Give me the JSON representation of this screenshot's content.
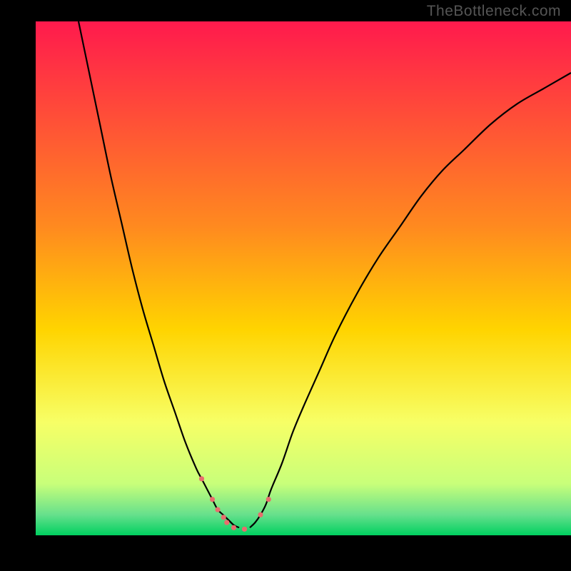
{
  "watermark": "TheBottleneck.com",
  "chart_data": {
    "type": "line",
    "title": "",
    "xlabel": "",
    "ylabel": "",
    "xlim": [
      0,
      100
    ],
    "ylim": [
      0,
      100
    ],
    "gradient": {
      "stops": [
        {
          "offset": 0.0,
          "color": "#ff1a4d"
        },
        {
          "offset": 0.4,
          "color": "#ff8a1f"
        },
        {
          "offset": 0.6,
          "color": "#ffd400"
        },
        {
          "offset": 0.78,
          "color": "#f7ff66"
        },
        {
          "offset": 0.9,
          "color": "#c8ff7a"
        },
        {
          "offset": 0.96,
          "color": "#66e08c"
        },
        {
          "offset": 1.0,
          "color": "#00d060"
        }
      ]
    },
    "series": [
      {
        "name": "left-curve",
        "x": [
          8,
          10,
          12,
          14,
          16,
          18,
          20,
          22,
          24,
          26,
          28,
          30,
          31,
          32,
          33,
          34,
          35,
          36,
          37,
          38
        ],
        "y": [
          100,
          90,
          80,
          70,
          61,
          52,
          44,
          37,
          30,
          24,
          18,
          13,
          11,
          9,
          7,
          5,
          4,
          3,
          2,
          1.5
        ]
      },
      {
        "name": "right-curve",
        "x": [
          40,
          41,
          42,
          43,
          44,
          46,
          48,
          50,
          53,
          56,
          60,
          64,
          68,
          72,
          76,
          80,
          85,
          90,
          95,
          100
        ],
        "y": [
          1.5,
          2.5,
          4,
          6,
          9,
          14,
          20,
          25,
          32,
          39,
          47,
          54,
          60,
          66,
          71,
          75,
          80,
          84,
          87,
          90
        ]
      }
    ],
    "markers": [
      {
        "x": 31,
        "y": 11
      },
      {
        "x": 33,
        "y": 7
      },
      {
        "x": 34,
        "y": 5
      },
      {
        "x": 35.1,
        "y": 3.5
      },
      {
        "x": 35.7,
        "y": 2.5
      },
      {
        "x": 37,
        "y": 1.5
      },
      {
        "x": 39,
        "y": 1.2
      },
      {
        "x": 42,
        "y": 4
      },
      {
        "x": 43.5,
        "y": 7
      }
    ],
    "marker_color": "#e86d6d",
    "marker_size_px": 7
  }
}
